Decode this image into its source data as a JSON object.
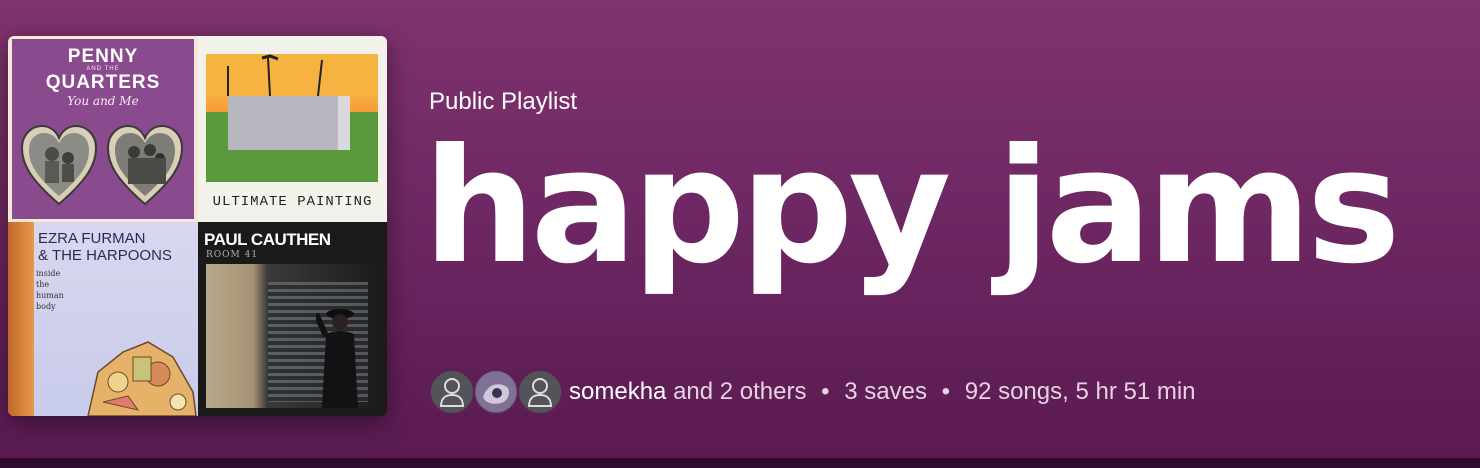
{
  "playlist": {
    "type_label": "Public Playlist",
    "title": "happy jams",
    "owner": "somekha",
    "collaborators_text": "and 2 others",
    "saves": "3 saves",
    "stats": "92 songs, 5 hr 51 min",
    "separator": "•"
  },
  "cover": {
    "tiles": [
      {
        "line1": "PENNY",
        "and": "AND THE",
        "line2": "QUARTERS",
        "sub": "You and Me"
      },
      {
        "label": "ULTIMATE PAINTING"
      },
      {
        "title_line1": "EZRA FURMAN",
        "title_line2": "& THE HARPOONS",
        "small_lines": [
          "inside",
          "the",
          "human",
          "body"
        ]
      },
      {
        "name": "PAUL CAUTHEN",
        "room": "ROOM 41"
      }
    ]
  },
  "avatars": [
    {
      "icon": "person-icon"
    },
    {
      "icon": "profile-photo"
    },
    {
      "icon": "person-icon"
    }
  ],
  "colors": {
    "header_gradient_top": "#7f336e",
    "header_gradient_bottom": "#5a1a52",
    "title_text": "#ffffff",
    "meta_text": "#e4d3e1"
  }
}
